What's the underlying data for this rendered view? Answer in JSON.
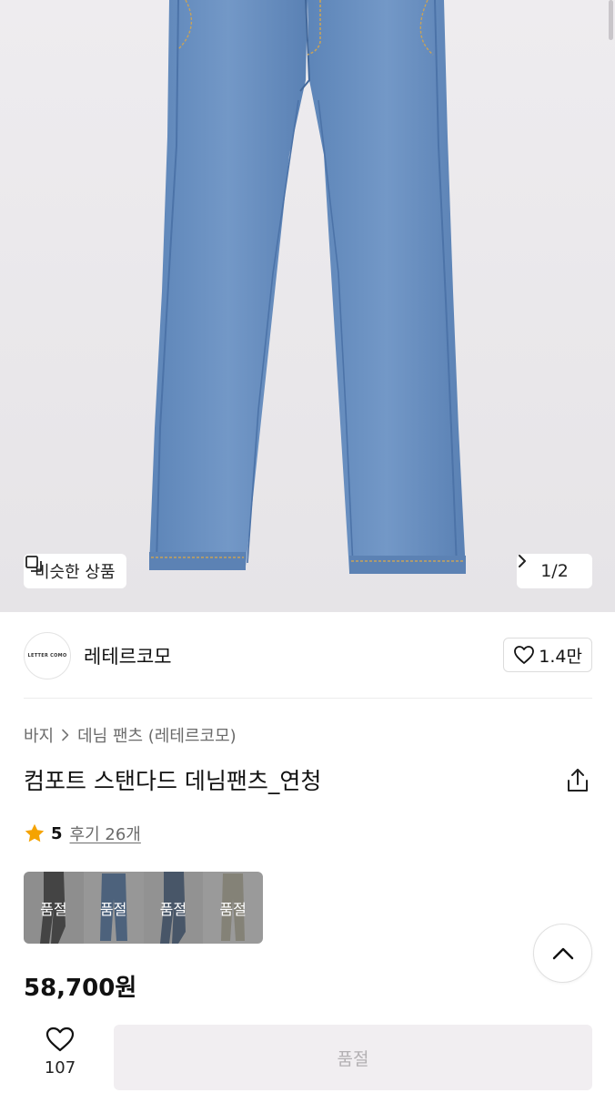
{
  "hero": {
    "similar_button_label": "비슷한 상품",
    "pager": {
      "current": "1",
      "separator": "/",
      "total": "2"
    }
  },
  "brand": {
    "logo_text": "LETTER COMO",
    "name": "레테르코모",
    "likes": "1.4만"
  },
  "breadcrumb": {
    "category": "바지",
    "subcategory": "데님 팬츠 (레테르코모)"
  },
  "product": {
    "title": "컴포트 스탠다드 데님팬츠_연청",
    "rating_score": "5",
    "reviews_label": "후기 26개",
    "price": "58,700원"
  },
  "swatches": [
    {
      "label": "품절",
      "color": "#2b2b2b"
    },
    {
      "label": "품절",
      "color": "#3f6ea7"
    },
    {
      "label": "품절",
      "color": "#34527a"
    },
    {
      "label": "품절",
      "color": "#b9b39c"
    }
  ],
  "bottom_bar": {
    "wish_count": "107",
    "purchase_label": "품절"
  },
  "colors": {
    "accent_star": "#f5a300",
    "denim": "#6e93c2",
    "disabled_button_bg": "#f1eef1",
    "disabled_button_text": "#b3b0b3"
  }
}
